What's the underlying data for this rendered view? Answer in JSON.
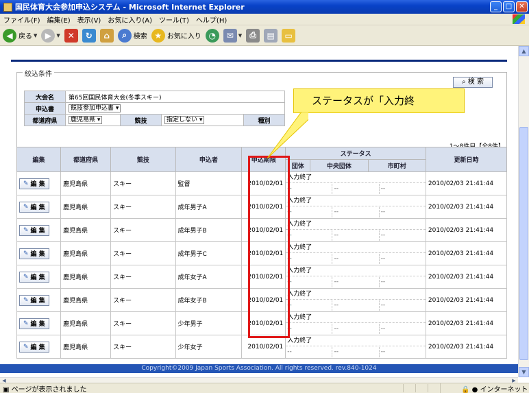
{
  "window": {
    "title": "国民体育大会参加申込システム - Microsoft Internet Explorer"
  },
  "menu": [
    "ファイル(F)",
    "編集(E)",
    "表示(V)",
    "お気に入り(A)",
    "ツール(T)",
    "ヘルプ(H)"
  ],
  "toolbar": {
    "back": "戻る",
    "search": "検索",
    "favorites": "お気に入り"
  },
  "filter": {
    "legend": "絞込条件",
    "search_button": "検 索",
    "taikai_label": "大会名",
    "taikai_value": "第65回国民体育大会(冬季スキー)",
    "moshikomisho_label": "申込書",
    "moshikomisho_value": "競技参加申込書",
    "pref_label": "都道府県",
    "pref_value": "鹿児島県",
    "kyogi_label": "競技",
    "kyogi_value": "指定しない",
    "shubetsu_label": "種別"
  },
  "callout": "ステータスが「入力終",
  "list": {
    "count": "1〜8件目【全8件】",
    "headers": {
      "edit": "編集",
      "pref": "都道府県",
      "kyogi": "競技",
      "applicant": "申込者",
      "deadline": "申込期限",
      "status": "ステータス",
      "dantai": "団体",
      "chuo": "中央団体",
      "shichoson": "市町村",
      "updated": "更新日時"
    },
    "edit_label": "編 集",
    "rows": [
      {
        "pref": "鹿児島県",
        "kyogi": "スキー",
        "applicant": "監督",
        "deadline": "2010/02/01",
        "status": "入力終了",
        "c1": "--",
        "c2": "--",
        "c3": "--",
        "updated": "2010/02/03 21:41:44"
      },
      {
        "pref": "鹿児島県",
        "kyogi": "スキー",
        "applicant": "成年男子A",
        "deadline": "2010/02/01",
        "status": "入力終了",
        "c1": "--",
        "c2": "--",
        "c3": "--",
        "updated": "2010/02/03 21:41:44"
      },
      {
        "pref": "鹿児島県",
        "kyogi": "スキー",
        "applicant": "成年男子B",
        "deadline": "2010/02/01",
        "status": "入力終了",
        "c1": "--",
        "c2": "--",
        "c3": "--",
        "updated": "2010/02/03 21:41:44"
      },
      {
        "pref": "鹿児島県",
        "kyogi": "スキー",
        "applicant": "成年男子C",
        "deadline": "2010/02/01",
        "status": "入力終了",
        "c1": "--",
        "c2": "--",
        "c3": "--",
        "updated": "2010/02/03 21:41:44"
      },
      {
        "pref": "鹿児島県",
        "kyogi": "スキー",
        "applicant": "成年女子A",
        "deadline": "2010/02/01",
        "status": "入力終了",
        "c1": "--",
        "c2": "--",
        "c3": "--",
        "updated": "2010/02/03 21:41:44"
      },
      {
        "pref": "鹿児島県",
        "kyogi": "スキー",
        "applicant": "成年女子B",
        "deadline": "2010/02/01",
        "status": "入力終了",
        "c1": "--",
        "c2": "--",
        "c3": "--",
        "updated": "2010/02/03 21:41:44"
      },
      {
        "pref": "鹿児島県",
        "kyogi": "スキー",
        "applicant": "少年男子",
        "deadline": "2010/02/01",
        "status": "入力終了",
        "c1": "--",
        "c2": "--",
        "c3": "--",
        "updated": "2010/02/03 21:41:44"
      },
      {
        "pref": "鹿児島県",
        "kyogi": "スキー",
        "applicant": "少年女子",
        "deadline": "2010/02/01",
        "status": "入力終了",
        "c1": "--",
        "c2": "--",
        "c3": "--",
        "updated": "2010/02/03 21:41:44"
      }
    ]
  },
  "footer": "Copyright©2009 Japan Sports Association. All rights reserved.    rev.840-1024",
  "status": {
    "text": "ページが表示されました",
    "zone": "インターネット"
  }
}
